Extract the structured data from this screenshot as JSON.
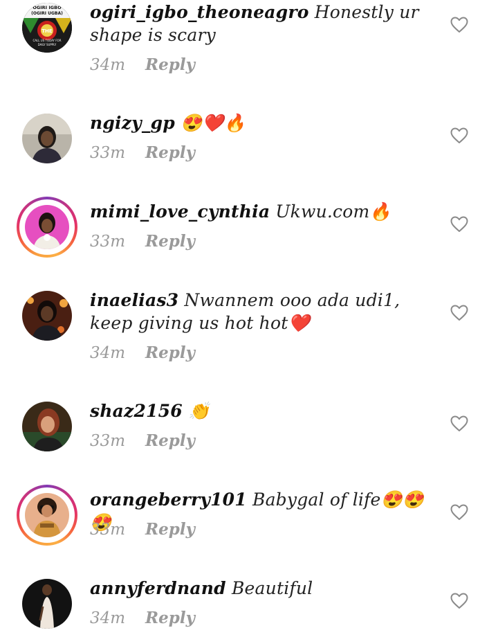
{
  "comments": [
    {
      "username": "ogiri_igbo_theoneagro",
      "text": " Honestly ur shape is scary",
      "time": "34m",
      "reply_label": "Reply",
      "story_ring": false,
      "avatar_icon": "ogiri-igbo-logo-avatar",
      "avatar_text": [
        "OGIRI IGBO",
        "(OGIRI UGBA)",
        "THE",
        "CALL US TODAY FOR",
        "DAILY SUPPLY"
      ]
    },
    {
      "username": "ngizy_gp",
      "text": " 😍❤️🔥",
      "time": "33m",
      "reply_label": "Reply",
      "story_ring": false,
      "avatar_icon": "woman-portrait-avatar"
    },
    {
      "username": "mimi_love_cynthia",
      "text": " Ukwu.com🔥",
      "time": "33m",
      "reply_label": "Reply",
      "story_ring": true,
      "avatar_icon": "woman-portrait-avatar"
    },
    {
      "username": "inaelias3",
      "text": " Nwannem ooo ada udi1, keep giving us hot hot❤️",
      "time": "34m",
      "reply_label": "Reply",
      "story_ring": false,
      "avatar_icon": "woman-portrait-avatar"
    },
    {
      "username": "shaz2156",
      "text": " 👏",
      "time": "33m",
      "reply_label": "Reply",
      "story_ring": false,
      "avatar_icon": "woman-portrait-avatar"
    },
    {
      "username": "orangeberry101",
      "text": " Babygal of life😍😍😍",
      "time": "33m",
      "reply_label": "Reply",
      "story_ring": true,
      "avatar_icon": "woman-portrait-avatar"
    },
    {
      "username": "annyferdnand",
      "text": " Beautiful",
      "time": "34m",
      "reply_label": "Reply",
      "story_ring": false,
      "avatar_icon": "woman-portrait-avatar"
    }
  ],
  "icons": {
    "like": "heart-outline-icon"
  },
  "colors": {
    "meta": "#9a9a9a",
    "text": "#111111",
    "ring_start": "#f9a03f",
    "ring_end": "#c13584"
  }
}
